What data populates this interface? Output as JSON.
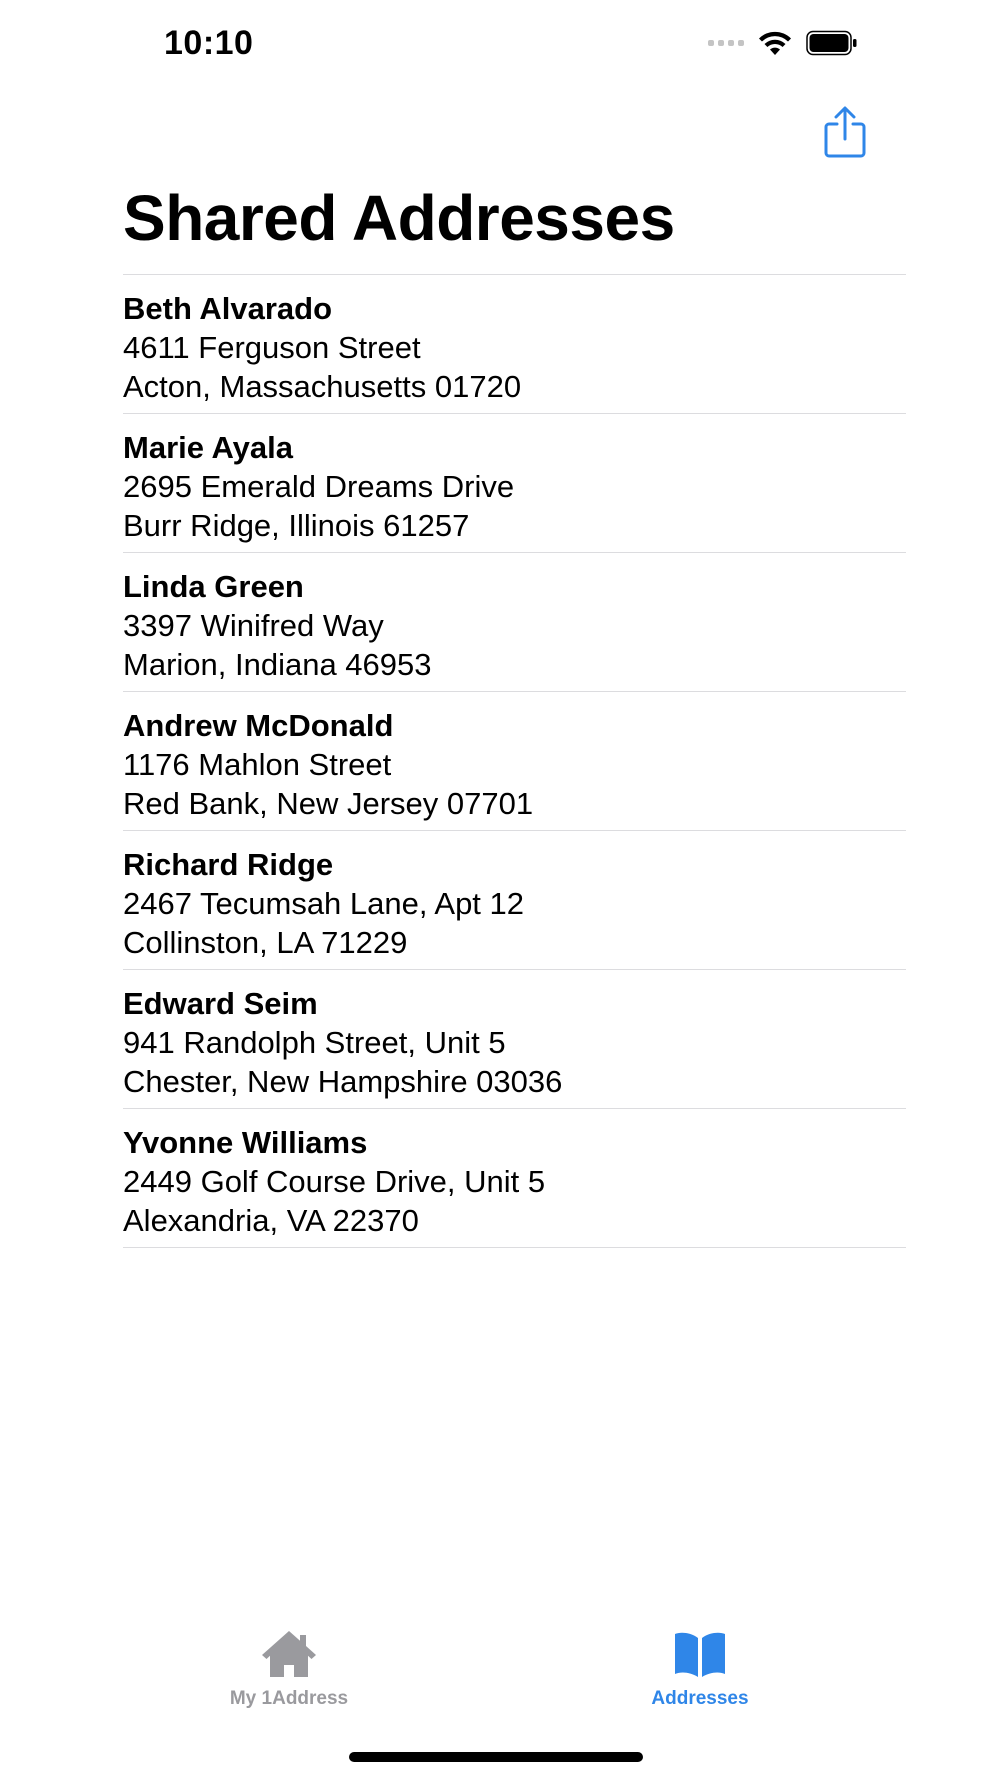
{
  "status_bar": {
    "time": "10:10"
  },
  "header": {
    "title": "Shared Addresses",
    "share_icon": "share-icon"
  },
  "contacts": [
    {
      "name": "Beth Alvarado",
      "street": "4611 Ferguson Street",
      "city_line": "Acton, Massachusetts 01720"
    },
    {
      "name": "Marie Ayala",
      "street": "2695 Emerald Dreams Drive",
      "city_line": "Burr Ridge, Illinois 61257"
    },
    {
      "name": "Linda Green",
      "street": "3397 Winifred Way",
      "city_line": "Marion, Indiana 46953"
    },
    {
      "name": "Andrew McDonald",
      "street": "1176 Mahlon Street",
      "city_line": "Red Bank, New Jersey 07701"
    },
    {
      "name": "Richard Ridge",
      "street": "2467 Tecumsah Lane, Apt 12",
      "city_line": "Collinston, LA 71229"
    },
    {
      "name": "Edward Seim",
      "street": "941 Randolph Street, Unit 5",
      "city_line": "Chester, New Hampshire 03036"
    },
    {
      "name": "Yvonne Williams",
      "street": "2449 Golf Course Drive, Unit 5",
      "city_line": "Alexandria, VA 22370"
    }
  ],
  "tab_bar": {
    "tabs": [
      {
        "label": "My 1Address",
        "icon": "house-icon",
        "selected": false
      },
      {
        "label": "Addresses",
        "icon": "book-icon",
        "selected": true
      }
    ]
  },
  "colors": {
    "accent": "#2f86e8",
    "inactive": "#9a9a9e",
    "separator": "#dcdcdf"
  }
}
